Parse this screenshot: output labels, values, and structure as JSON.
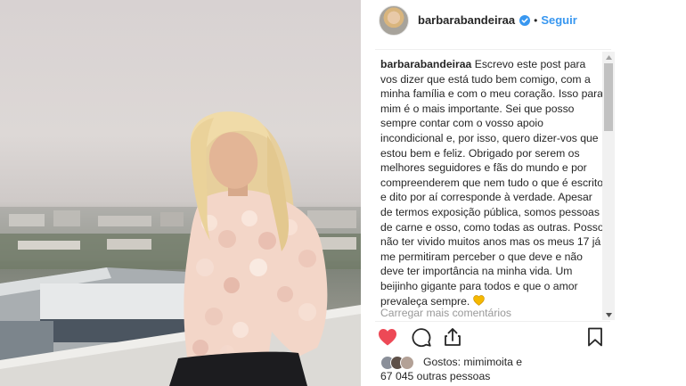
{
  "post": {
    "username": "barbarabandeiraa",
    "separator": "•",
    "follow_label": "Seguir",
    "caption_user": "barbarabandeiraa",
    "caption_text": "Escrevo este post para vos dizer que está tudo bem comigo, com a minha família e com o meu coração. Isso para mim é o mais importante. Sei que posso sempre contar com o vosso apoio incondicional e, por isso, quero dizer-vos que estou bem e feliz. Obrigado por serem os melhores seguidores e fãs do mundo e por compreenderem que nem tudo o que é escrito e dito por aí corresponde à verdade. Apesar de termos exposição pública, somos pessoas de carne e osso, como todas as outras. Posso não ter vivido muitos anos mas os meus 17 já me permitiram perceber o que deve e não deve ter importância na minha vida. Um beijinho gigante para todos e que o amor prevaleça sempre.",
    "caption_emoji": "yellow-heart-emoji",
    "load_more_label": "Carregar mais comentários",
    "likes_line1": "Gostos: mimimoita e",
    "likes_line2": "67 045 outras pessoas",
    "liked": true
  },
  "icons": {
    "verified": "verified-badge-icon",
    "like": "heart-icon",
    "comment": "comment-icon",
    "share": "share-icon",
    "save": "bookmark-icon"
  },
  "colors": {
    "link": "#3897f0",
    "liked_heart": "#ed4956",
    "text": "#262626",
    "muted": "#999999",
    "emoji_heart": "#f5b800"
  }
}
